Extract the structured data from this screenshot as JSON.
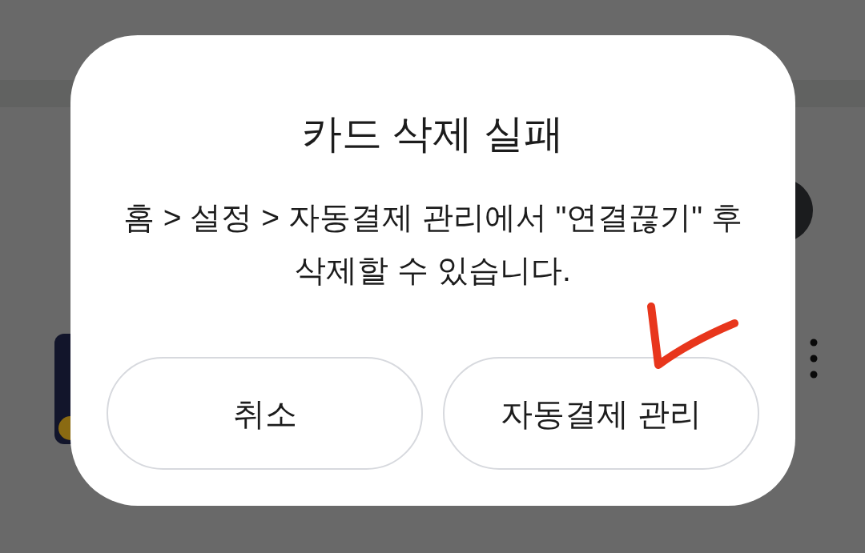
{
  "dialog": {
    "title": "카드 삭제 실패",
    "message": "홈 > 설정 > 자동결제 관리에서 \"연결끊기\" 후\n삭제할 수 있습니다.",
    "buttons": [
      "취소",
      "자동결제 관리"
    ]
  },
  "overlay_marks": [
    {
      "kind": "check"
    }
  ]
}
